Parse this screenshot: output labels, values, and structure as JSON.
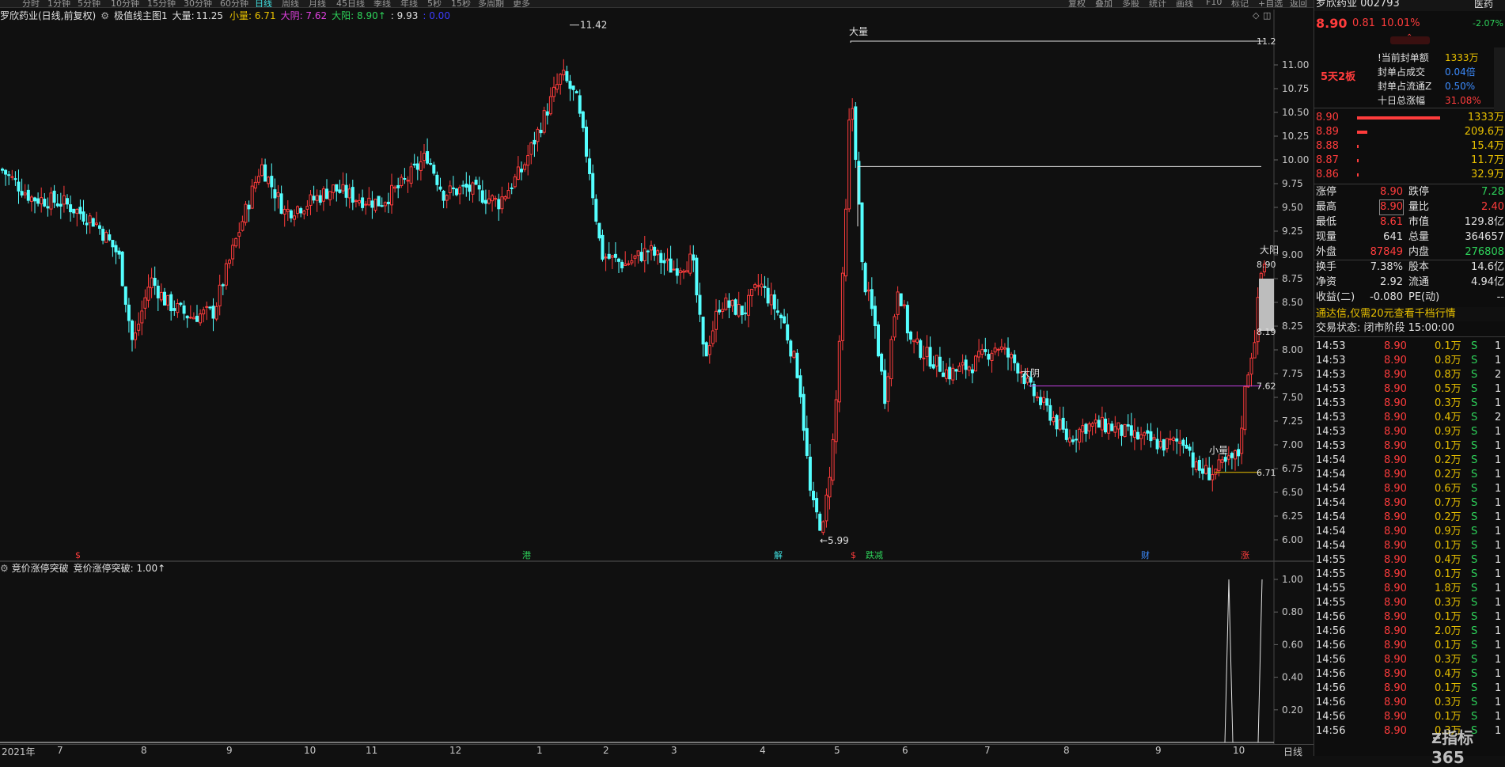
{
  "toolbar": {
    "periods": [
      "分时",
      "1分钟",
      "5分钟",
      "10分钟",
      "15分钟",
      "30分钟",
      "60分钟",
      "日线",
      "周线",
      "月线",
      "45日线",
      "季线",
      "年线",
      "5秒",
      "15秒",
      "多周期",
      "更多"
    ],
    "right_buttons": [
      "复权",
      "叠加",
      "多股",
      "统计",
      "画线",
      "F10",
      "标记",
      "+自选",
      "返回"
    ]
  },
  "info": {
    "stock_name": "罗欣药业(日线,前复权)",
    "indicator": "极值线主图1",
    "daliang_label": "大量:",
    "daliang_value": "11.25",
    "xiaoliang": "小量: 6.71",
    "dayin": "大阴: 7.62",
    "dayang": "大阳: 8.90↑",
    "v1": ": 9.93",
    "v2": ": 0.00"
  },
  "lower": {
    "name": "竞价涨停突破",
    "value_label": "竞价涨停突破: 1.00↑"
  },
  "annotations": {
    "high": "11.42",
    "low": "←5.99",
    "daliang": "大量",
    "dayin": "大阴",
    "xiaoliang": "小量",
    "dayang": "大阳",
    "right_1125": "11.2",
    "right_893": "8.90",
    "right_819": "8.19",
    "right_762": "7.62",
    "right_671": "6.71"
  },
  "event_markers": [
    {
      "text": "$",
      "color": "#ff3c3c"
    },
    {
      "text": "港",
      "color": "#2ed25a"
    },
    {
      "text": "解",
      "color": "#40e0e0"
    },
    {
      "text": "$",
      "color": "#ff3c3c"
    },
    {
      "text": "跌减",
      "color": "#2ed25a"
    },
    {
      "text": "财",
      "color": "#3c8cff"
    },
    {
      "text": "涨",
      "color": "#ff3c3c"
    }
  ],
  "date_axis": [
    "2021年",
    "7",
    "8",
    "9",
    "10",
    "11",
    "12",
    "1",
    "2",
    "3",
    "4",
    "5",
    "6",
    "7",
    "8",
    "9",
    "10",
    "日线"
  ],
  "chart_data": {
    "type": "candlestick",
    "y_ticks": [
      "11.00",
      "10.75",
      "10.50",
      "10.25",
      "10.00",
      "9.75",
      "9.50",
      "9.25",
      "9.00",
      "8.75",
      "8.50",
      "8.25",
      "8.00",
      "7.75",
      "7.50",
      "7.25",
      "7.00",
      "6.75",
      "6.50",
      "6.25",
      "6.00"
    ],
    "ylim": [
      5.9,
      11.5
    ],
    "levels": {
      "daliang": 11.25,
      "v1": 9.93,
      "dayin": 7.62,
      "xiaoliang": 6.71,
      "dayang": 8.9
    },
    "key_points": {
      "high": 11.42,
      "low": 5.99,
      "last": 8.9
    },
    "lower_y_ticks": [
      "1.00",
      "0.80",
      "0.60",
      "0.40",
      "0.20"
    ],
    "lower_ylim": [
      0,
      1.0
    ]
  },
  "right_panel": {
    "title": "罗欣药业 002793",
    "industry": "医药",
    "price": "8.90",
    "change": "0.81",
    "pct": "10.01%",
    "pct2": "-2.07%",
    "streak": "5天2板",
    "seal_rows": [
      {
        "label": "!当前封单额",
        "value": "1333万",
        "color": "#e8c000"
      },
      {
        "label": "封单占成交",
        "value": "0.04倍",
        "color": "#3c8cff"
      },
      {
        "label": "封单占流通Z",
        "value": "0.50%",
        "color": "#3c8cff"
      },
      {
        "label": "十日总涨幅",
        "value": "31.08%",
        "color": "#ff3c3c"
      }
    ],
    "bid_rows": [
      {
        "price": "8.90",
        "vol": "1333万",
        "bar": 0.95
      },
      {
        "price": "8.89",
        "vol": "209.6万",
        "bar": 0.12
      },
      {
        "price": "8.88",
        "vol": "15.4万",
        "bar": 0.02
      },
      {
        "price": "8.87",
        "vol": "11.7万",
        "bar": 0.02
      },
      {
        "price": "8.86",
        "vol": "32.9万",
        "bar": 0.02
      }
    ],
    "stats": [
      {
        "l1": "涨停",
        "v1": "8.90",
        "c1": "#ff3c3c",
        "l2": "跌停",
        "v2": "7.28",
        "c2": "#2ed25a"
      },
      {
        "l1": "最高",
        "v1": "8.90",
        "c1": "#ff3c3c",
        "l2": "量比",
        "v2": "2.40",
        "c2": "#ff3c3c"
      },
      {
        "l1": "最低",
        "v1": "8.61",
        "c1": "#ff3c3c",
        "l2": "市值",
        "v2": "129.8亿",
        "c2": "#e0e0e0"
      },
      {
        "l1": "现量",
        "v1": "641",
        "c1": "#e0e0e0",
        "l2": "总量",
        "v2": "364657",
        "c2": "#e0e0e0"
      },
      {
        "l1": "外盘",
        "v1": "87849",
        "c1": "#ff3c3c",
        "l2": "内盘",
        "v2": "276808",
        "c2": "#2ed25a"
      },
      {
        "l1": "换手",
        "v1": "7.38%",
        "c1": "#e0e0e0",
        "l2": "股本",
        "v2": "14.6亿",
        "c2": "#e0e0e0"
      },
      {
        "l1": "净资",
        "v1": "2.92",
        "c1": "#e0e0e0",
        "l2": "流通",
        "v2": "4.94亿",
        "c2": "#e0e0e0"
      },
      {
        "l1": "收益(二)",
        "v1": "-0.080",
        "c1": "#e0e0e0",
        "l2": "PE(动)",
        "v2": "--",
        "c2": "#e0e0e0"
      }
    ],
    "notice": "通达信,仅需20元查看千档行情",
    "trade_status": "交易状态: 闭市阶段 15:00:00",
    "ticks": [
      {
        "t": "14:53",
        "p": "8.90",
        "v": "0.1万",
        "s": "S"
      },
      {
        "t": "14:53",
        "p": "8.90",
        "v": "0.8万",
        "s": "S"
      },
      {
        "t": "14:53",
        "p": "8.90",
        "v": "0.8万",
        "s": "S"
      },
      {
        "t": "14:53",
        "p": "8.90",
        "v": "0.5万",
        "s": "S"
      },
      {
        "t": "14:53",
        "p": "8.90",
        "v": "0.3万",
        "s": "S"
      },
      {
        "t": "14:53",
        "p": "8.90",
        "v": "0.4万",
        "s": "S"
      },
      {
        "t": "14:53",
        "p": "8.90",
        "v": "0.9万",
        "s": "S"
      },
      {
        "t": "14:53",
        "p": "8.90",
        "v": "0.1万",
        "s": "S"
      },
      {
        "t": "14:54",
        "p": "8.90",
        "v": "0.2万",
        "s": "S"
      },
      {
        "t": "14:54",
        "p": "8.90",
        "v": "0.2万",
        "s": "S"
      },
      {
        "t": "14:54",
        "p": "8.90",
        "v": "0.6万",
        "s": "S"
      },
      {
        "t": "14:54",
        "p": "8.90",
        "v": "0.7万",
        "s": "S"
      },
      {
        "t": "14:54",
        "p": "8.90",
        "v": "0.2万",
        "s": "S"
      },
      {
        "t": "14:54",
        "p": "8.90",
        "v": "0.9万",
        "s": "S"
      },
      {
        "t": "14:54",
        "p": "8.90",
        "v": "0.1万",
        "s": "S"
      },
      {
        "t": "14:55",
        "p": "8.90",
        "v": "0.4万",
        "s": "S"
      },
      {
        "t": "14:55",
        "p": "8.90",
        "v": "0.1万",
        "s": "S"
      },
      {
        "t": "14:55",
        "p": "8.90",
        "v": "1.8万",
        "s": "S"
      },
      {
        "t": "14:55",
        "p": "8.90",
        "v": "0.3万",
        "s": "S"
      },
      {
        "t": "14:56",
        "p": "8.90",
        "v": "0.1万",
        "s": "S"
      },
      {
        "t": "14:56",
        "p": "8.90",
        "v": "2.0万",
        "s": "S"
      },
      {
        "t": "14:56",
        "p": "8.90",
        "v": "0.1万",
        "s": "S"
      },
      {
        "t": "14:56",
        "p": "8.90",
        "v": "0.3万",
        "s": "S"
      },
      {
        "t": "14:56",
        "p": "8.90",
        "v": "0.4万",
        "s": "S"
      },
      {
        "t": "14:56",
        "p": "8.90",
        "v": "0.1万",
        "s": "S"
      },
      {
        "t": "14:56",
        "p": "8.90",
        "v": "0.3万",
        "s": "S"
      },
      {
        "t": "14:56",
        "p": "8.90",
        "v": "0.1万",
        "s": "S"
      },
      {
        "t": "14:56",
        "p": "8.90",
        "v": "0.3万",
        "s": "S"
      }
    ],
    "tick_edge": [
      "1",
      "1",
      "2",
      "1",
      "1",
      "2",
      "1",
      "1",
      "1",
      "1",
      "1",
      "1",
      "1",
      "1",
      "1",
      "1",
      "1",
      "1",
      "1",
      "1",
      "1",
      "1",
      "1",
      "1",
      "1",
      "1",
      "1",
      "1"
    ],
    "watermark": "指标365"
  }
}
